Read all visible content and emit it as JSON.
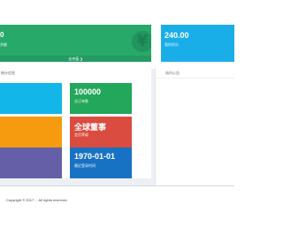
{
  "balance_panel": {
    "value": "0",
    "subtitle": "余额",
    "footer_link": "去充值 ❯",
    "icon": "yen-icon"
  },
  "points_panel": {
    "value": "240.00",
    "subtitle": "我的积分"
  },
  "stats_box": {
    "title": "统计信息",
    "tiles": [
      {
        "value": "",
        "label": "",
        "color": "#12b6e8"
      },
      {
        "value": "100000",
        "label": "总订单数",
        "color": "#23a75a"
      },
      {
        "value": "",
        "label": "",
        "color": "#f69b0f"
      },
      {
        "value": "全球董事",
        "label": "会员等级",
        "color": "#da4c3f"
      },
      {
        "value": "",
        "label": "",
        "color": "#655fa7"
      },
      {
        "value": "1970-01-01",
        "label": "最近登录时间",
        "color": "#1872c4"
      }
    ]
  },
  "notice_box": {
    "title": "站内公告"
  },
  "footer": {
    "copyright": "Copyright © 2017 ... All rights reserved."
  }
}
